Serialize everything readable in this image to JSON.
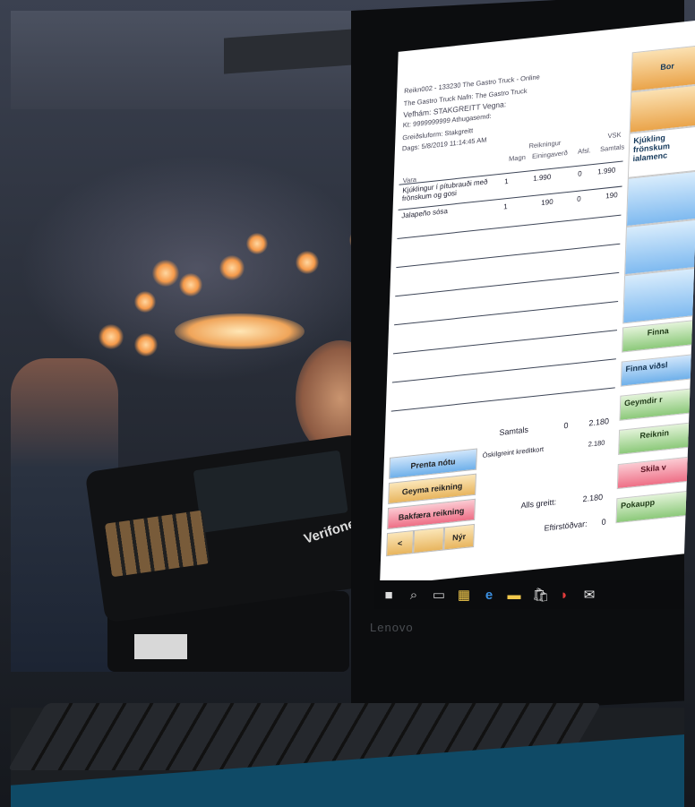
{
  "pos": {
    "header": {
      "line1": "Reikn002 - 133230  The Gastro Truck - Online",
      "line2": "The Gastro Truck   Nafn: The Gastro Truck",
      "line3": "Vefhám: STAKGREITT   Vegna:",
      "line4": "Kt: 9999999999   Athugasemd:",
      "line5": "Greiðsluform: Stakgreitt",
      "line6": "Dags: 5/8/2019 11:14:45 AM"
    },
    "columns": {
      "group": "Reikningur",
      "group_right": "VSK",
      "qty": "Magn",
      "unit_price": "Einingaverð",
      "discount": "Afsl.",
      "total": "Samtals",
      "item": "Vara"
    },
    "items": [
      {
        "name": "Kjúklingur í pítubrauði með frönskum og gosi",
        "qty": "1",
        "unit": "1.990",
        "discount": "0",
        "total": "1.990"
      },
      {
        "name": "Jalapeño sósa",
        "qty": "1",
        "unit": "190",
        "discount": "0",
        "total": "190"
      }
    ],
    "summary": {
      "samtals_label": "Samtals",
      "samtals_discount": "0",
      "samtals_total": "2.180",
      "payment_method": "Óskilgreint kreditkort",
      "payment_amount": "2.180",
      "paid_label": "Alls greitt:",
      "paid_amount": "2.180",
      "remaining_label": "Eftirstöðvar:",
      "remaining_amount": "0"
    },
    "buttons": {
      "print": "Prenta nótu",
      "store": "Geyma reikning",
      "reverse": "Bakfæra reikning",
      "back": "<",
      "new": "Nýr"
    },
    "side": {
      "top": "Bor",
      "product": "Kjúkling frönskum ialamenc",
      "find": "Finna",
      "find_customer": "Finna viðsl",
      "stored": "Geymdir r",
      "invoices": "Reiknin",
      "return": "Skila v",
      "bag": "Pokaupp"
    }
  },
  "taskbar": {
    "icons": [
      "windows-icon",
      "search-icon",
      "task-view-icon",
      "calculator-icon",
      "edge-icon",
      "folder-icon",
      "store-icon",
      "app-icon",
      "mail-icon"
    ]
  },
  "devices": {
    "terminal_brand": "Verifone",
    "laptop_brand": "Lenovo"
  },
  "colors": {
    "banner": "#0f4a66",
    "accent_blue": "#6fb0ea",
    "accent_green": "#8cc97a",
    "accent_pink": "#ee6f86",
    "accent_yellow": "#e8b55e"
  }
}
